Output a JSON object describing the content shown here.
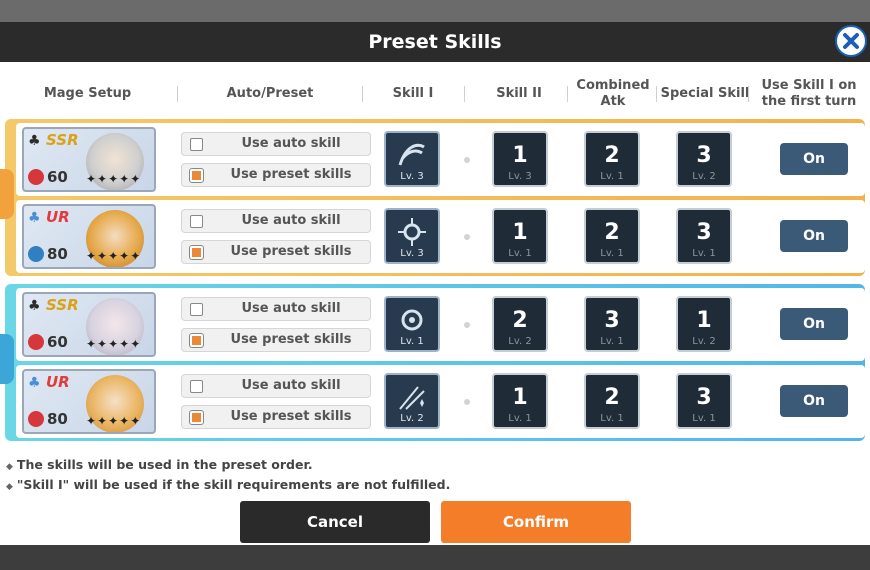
{
  "dialog": {
    "title": "Preset Skills"
  },
  "headers": {
    "mage_setup": "Mage Setup",
    "auto_preset": "Auto/Preset",
    "skill1": "Skill I",
    "skill2": "Skill II",
    "combined_atk": "Combined Atk",
    "special_skill": "Special Skill",
    "use_skill_first": "Use Skill I on the first turn"
  },
  "rows": [
    {
      "rarity": "SSR",
      "level": "60",
      "auto_label": "Use auto skill",
      "preset_label": "Use preset skills",
      "skill1_lv": "Lv. 3",
      "skill2_num": "1",
      "skill2_lv": "Lv. 3",
      "combined_num": "2",
      "combined_lv": "Lv. 1",
      "special_num": "3",
      "special_lv": "Lv. 2",
      "toggle": "On"
    },
    {
      "rarity": "UR",
      "level": "80",
      "auto_label": "Use auto skill",
      "preset_label": "Use preset skills",
      "skill1_lv": "Lv. 3",
      "skill2_num": "1",
      "skill2_lv": "Lv. 1",
      "combined_num": "2",
      "combined_lv": "Lv. 1",
      "special_num": "3",
      "special_lv": "Lv. 1",
      "toggle": "On"
    },
    {
      "rarity": "SSR",
      "level": "60",
      "auto_label": "Use auto skill",
      "preset_label": "Use preset skills",
      "skill1_lv": "Lv. 1",
      "skill2_num": "2",
      "skill2_lv": "Lv. 2",
      "combined_num": "3",
      "combined_lv": "Lv. 1",
      "special_num": "1",
      "special_lv": "Lv. 2",
      "toggle": "On"
    },
    {
      "rarity": "UR",
      "level": "80",
      "auto_label": "Use auto skill",
      "preset_label": "Use preset skills",
      "skill1_lv": "Lv. 2",
      "skill2_num": "1",
      "skill2_lv": "Lv. 1",
      "combined_num": "2",
      "combined_lv": "Lv. 1",
      "special_num": "3",
      "special_lv": "Lv. 1",
      "toggle": "On"
    }
  ],
  "notes": {
    "line1": "The skills will be used in the preset order.",
    "line2": "\"Skill I\" will be used if the skill requirements are not fulfilled."
  },
  "buttons": {
    "cancel": "Cancel",
    "confirm": "Confirm"
  },
  "colors": {
    "title_bar": "#2b2b2b",
    "group_gold": "#f4c969",
    "group_blue": "#52b6e8",
    "toggle_on": "#3b5a78",
    "confirm": "#f47d2a",
    "cancel": "#2a2a2a"
  }
}
